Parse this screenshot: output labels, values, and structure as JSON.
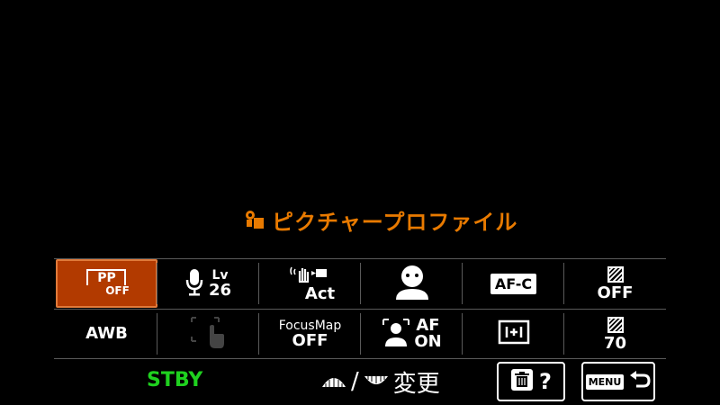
{
  "title": "ピクチャープロファイル",
  "row1": {
    "pp_label": "PP",
    "pp_value": "OFF",
    "mic_label": "Lv",
    "mic_value": "26",
    "steady_value": "Act",
    "af_c_label": "AF-C",
    "zebra_value": "OFF"
  },
  "row2": {
    "awb_label": "AWB",
    "focusmap_label": "FocusMap",
    "focusmap_value": "OFF",
    "face_af_label": "AF",
    "face_af_value": "ON",
    "zebra_level": "70"
  },
  "bottom": {
    "status": "STBY",
    "change_label": "変更",
    "separator": "/",
    "help_glyph": "?",
    "menu_badge": "MENU"
  },
  "colors": {
    "accent": "#e87a00",
    "selected_bg": "#b23a00",
    "status_green": "#1fd11f"
  }
}
